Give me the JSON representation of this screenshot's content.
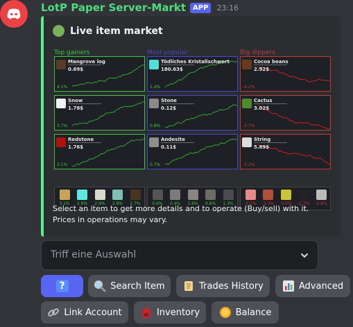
{
  "message": {
    "bot_name": "LotP Paper Server-Markt",
    "app_badge": "APP",
    "timestamp": "23:16"
  },
  "embed": {
    "title": "Live item market",
    "accent_color": "#57f287",
    "description_line1": "Select an item to get more details and to operate (Buy/sell) with it.",
    "description_line2": "Prices in operations may vary."
  },
  "market": {
    "columns": [
      {
        "heading": "Top gainers",
        "color": "#3ec83e",
        "items": [
          {
            "name": "Mangrove log",
            "price": "0.69$",
            "change": "4.1%",
            "icon": "mangrove-log-icon"
          },
          {
            "name": "Snow",
            "price": "1.78$",
            "change": "3.7%",
            "icon": "snow-icon"
          },
          {
            "name": "Redstone",
            "price": "1.76$",
            "change": "3.1%",
            "icon": "redstone-icon"
          }
        ]
      },
      {
        "heading": "Most popular",
        "color": "#4747d1",
        "items": [
          {
            "name": "Tödliches Kristallschwert",
            "price": "180.63$",
            "change": "1.4%",
            "icon": "diamond-sword-icon"
          },
          {
            "name": "Stone",
            "price": "0.12$",
            "change": "0.8%",
            "icon": "stone-icon"
          },
          {
            "name": "Andesite",
            "price": "0.11$",
            "change": "0.7%",
            "icon": "andesite-icon"
          }
        ]
      },
      {
        "heading": "Big dippers",
        "color": "#c43a3a",
        "items": [
          {
            "name": "Cocoa beans",
            "price": "2.92$",
            "change": "-4.2%",
            "icon": "cocoa-beans-icon"
          },
          {
            "name": "Cactus",
            "price": "3.02$",
            "change": "-3.7%",
            "icon": "cactus-icon"
          },
          {
            "name": "String",
            "price": "5.89$",
            "change": "-3.2%",
            "icon": "string-icon"
          }
        ]
      }
    ],
    "mini_rows": [
      [
        {
          "change": "3.1%",
          "icon": "stick-icon",
          "color": "#c8a45a"
        },
        {
          "change": "2.9%",
          "icon": "diamond-icon",
          "color": "#5ee8e0"
        },
        {
          "change": "2.9%",
          "icon": "bone-icon",
          "color": "#d8d8cc"
        },
        {
          "change": "2.8%",
          "icon": "prismarine-icon",
          "color": "#7fbfb0"
        },
        {
          "change": "2.7%",
          "icon": "dark-oak-log-icon",
          "color": "#4a3320"
        }
      ],
      [
        {
          "change": "0.6%",
          "icon": "deepslate-icon",
          "color": "#555"
        },
        {
          "change": "0.4%",
          "icon": "cobblestone-icon",
          "color": "#7c7c7c"
        },
        {
          "change": "1.6%",
          "icon": "gravel-icon",
          "color": "#8a8580"
        },
        {
          "change": "0.6%",
          "icon": "tuff-icon",
          "color": "#6c6c64"
        },
        {
          "change": "1.3%",
          "icon": "cobbled-deepslate-icon",
          "color": "#4c4c4c"
        }
      ],
      [
        {
          "change": "-3.2%",
          "icon": "porkchop-icon",
          "color": "#e88a8a"
        },
        {
          "change": "-3.2%",
          "icon": "bricks-icon",
          "color": "#b0503a"
        },
        {
          "change": "-3.0%",
          "icon": "sponge-icon",
          "color": "#c9c43a"
        },
        {
          "change": "-2.7%",
          "icon": "coal-icon",
          "color": "#222"
        },
        {
          "change": "-2.6%",
          "icon": "iron-bars-icon",
          "color": "#bbb"
        }
      ]
    ]
  },
  "select": {
    "placeholder": "Triff eine Auswahl"
  },
  "buttons": {
    "help": "?",
    "search_item": "Search Item",
    "trades_history": "Trades History",
    "advanced": "Advanced",
    "link_account": "Link Account",
    "inventory": "Inventory",
    "balance": "Balance"
  }
}
